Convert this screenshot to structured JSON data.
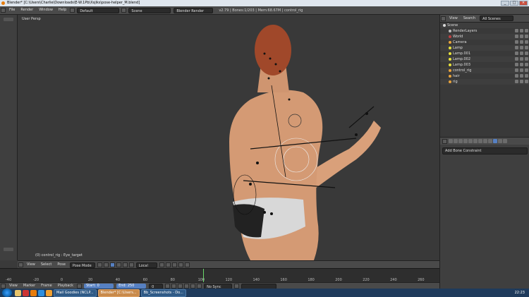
{
  "titlebar": {
    "title": "Blender* [C:\\Users\\Charlie\\Downloads\\E-W.1Pb\\Xsjiks\\pose-helper_M.blend]"
  },
  "topbar": {
    "menus": [
      "File",
      "Render",
      "Window",
      "Help"
    ],
    "layout": "Default",
    "scene": "Scene",
    "engine": "Blender Render",
    "stats": "v2.79 | Bones:1/203 | Mem:68.67M | control_rig"
  },
  "viewport": {
    "label": "User Persp",
    "status": "(0) control_rig : Eye_target"
  },
  "header3d": {
    "menus": [
      "View",
      "Select",
      "Pose"
    ],
    "mode": "Pose Mode",
    "orientation": "Local"
  },
  "timeline": {
    "numbers": [
      "-40",
      "-20",
      "0",
      "20",
      "40",
      "60",
      "80",
      "100",
      "120",
      "140",
      "160",
      "180",
      "200",
      "220",
      "240",
      "260"
    ],
    "menus": [
      "View",
      "Marker",
      "Frame",
      "Playback"
    ],
    "start_label": "Start:",
    "start_value": "0",
    "end_label": "End:",
    "end_value": "250",
    "current": "0",
    "sync": "No Sync"
  },
  "outliner": {
    "menus": [
      "View",
      "Search"
    ],
    "filter": "All Scenes",
    "items": [
      {
        "label": "Scene",
        "indent": 0,
        "color": "#d9d9d9"
      },
      {
        "label": "RenderLayers",
        "indent": 1,
        "color": "#c0c0c0"
      },
      {
        "label": "World",
        "indent": 1,
        "color": "#c04040"
      },
      {
        "label": "Camera",
        "indent": 1,
        "color": "#e8a33c"
      },
      {
        "label": "Lamp",
        "indent": 1,
        "color": "#e8e23c"
      },
      {
        "label": "Lamp.001",
        "indent": 1,
        "color": "#e8e23c"
      },
      {
        "label": "Lamp.002",
        "indent": 1,
        "color": "#e8e23c"
      },
      {
        "label": "Lamp.003",
        "indent": 1,
        "color": "#e8e23c"
      },
      {
        "label": "control_rig",
        "indent": 1,
        "color": "#e8a33c"
      },
      {
        "label": "hair",
        "indent": 1,
        "color": "#e8a33c"
      },
      {
        "label": "rig",
        "indent": 1,
        "color": "#e8a33c"
      }
    ]
  },
  "properties": {
    "add_bone_constraint": "Add Bone Constraint"
  },
  "taskbar": {
    "buttons": [
      "Mail Goodies (NCLP...",
      "Blender* [C:\\Users...",
      "Bb_Screenshots - Do..."
    ],
    "time": "22:23"
  },
  "colors": {
    "accent": "#5680c2",
    "playhead": "#6ad86a",
    "taskbar": "#1f3b5c"
  }
}
